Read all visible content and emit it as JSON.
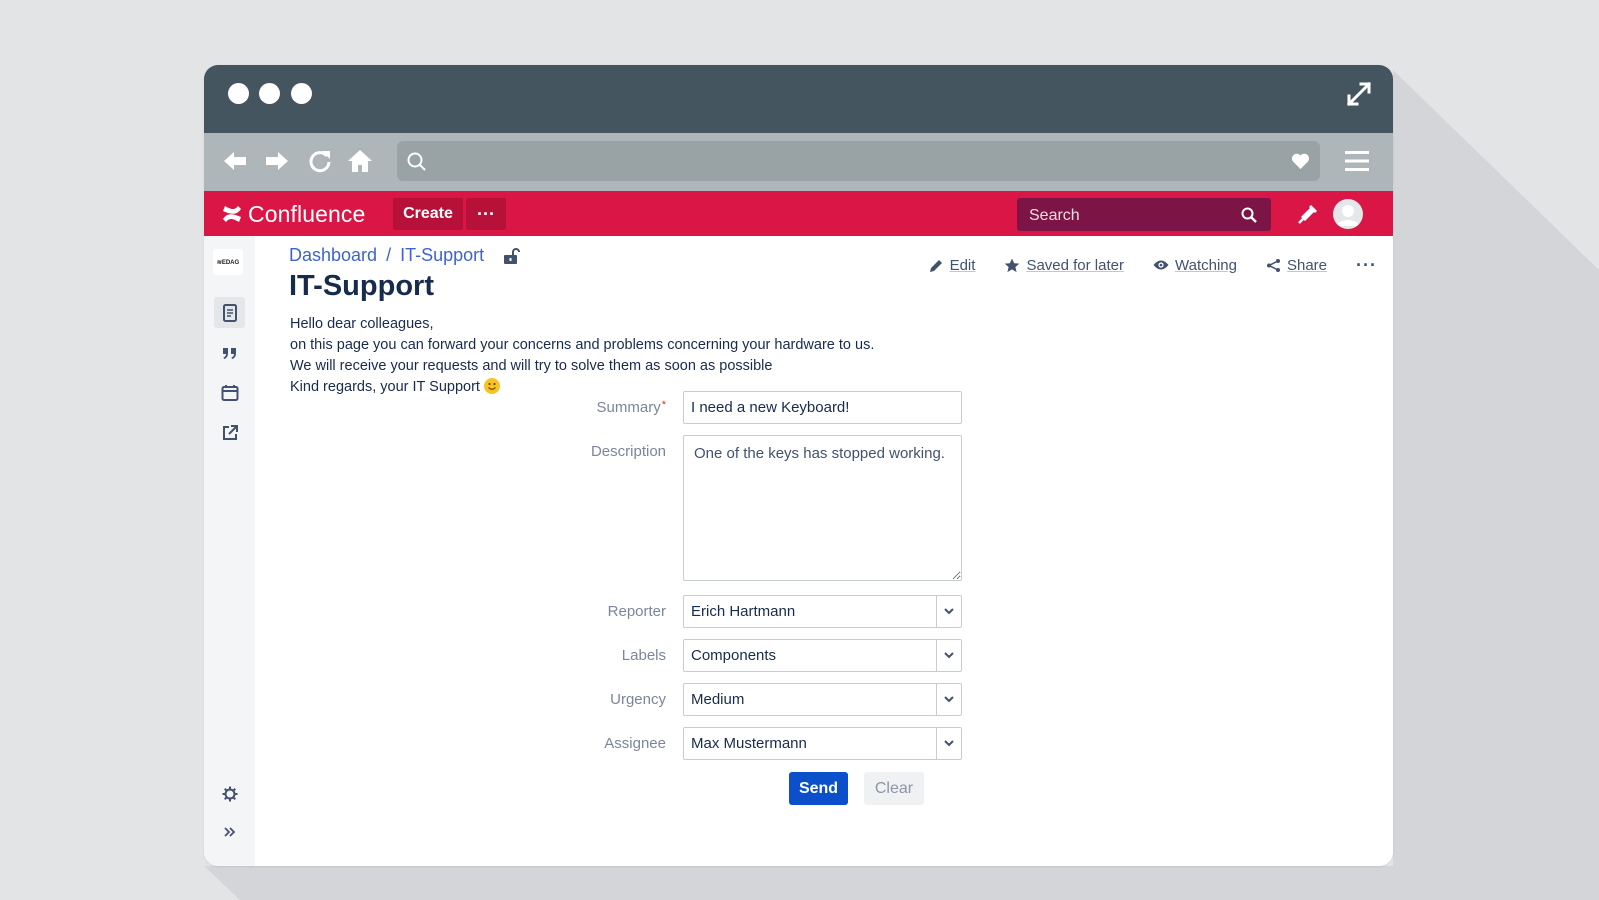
{
  "browser": {
    "address": ""
  },
  "confluence": {
    "logo_text": "Confluence",
    "create_label": "Create",
    "more_label": "···",
    "search_placeholder": "Search"
  },
  "sidebar": {
    "space_logo_text": "≋EDAG"
  },
  "breadcrumb": {
    "items": [
      "Dashboard",
      "IT-Support"
    ],
    "separator": "/"
  },
  "page": {
    "title": "IT-Support",
    "actions": {
      "edit": "Edit",
      "saved": "Saved for later",
      "watching": "Watching",
      "share": "Share",
      "more": "···"
    },
    "intro": [
      "Hello dear colleagues,",
      "on this page you can forward your concerns and problems concerning your hardware to us.",
      "We will receive your requests and will try to solve them as soon as possible",
      "Kind regards, your IT Support"
    ]
  },
  "form": {
    "summary": {
      "label": "Summary",
      "required_mark": "*",
      "value": "I need a new Keyboard!"
    },
    "description": {
      "label": "Description",
      "value": "One of the keys has stopped working."
    },
    "reporter": {
      "label": "Reporter",
      "value": "Erich Hartmann"
    },
    "labels": {
      "label": "Labels",
      "value": "Components"
    },
    "urgency": {
      "label": "Urgency",
      "value": "Medium"
    },
    "assignee": {
      "label": "Assignee",
      "value": "Max Mustermann"
    },
    "send_label": "Send",
    "clear_label": "Clear"
  },
  "colors": {
    "confluence_red": "#d91646",
    "titlebar": "#455560",
    "toolbar": "#afb6b9",
    "primary_button": "#0b4fca"
  }
}
